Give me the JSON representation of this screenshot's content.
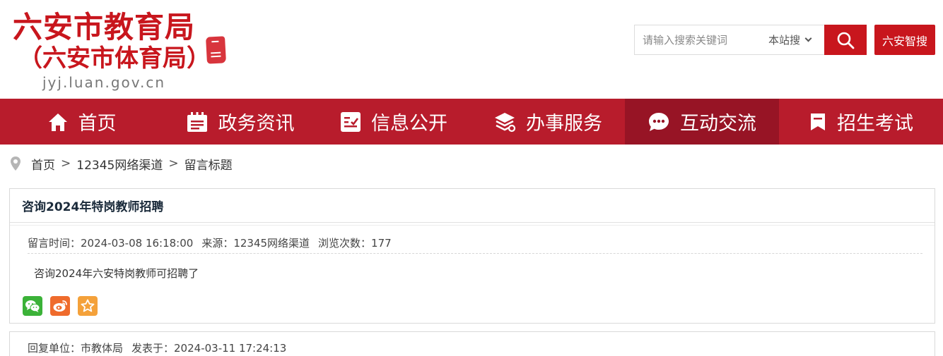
{
  "site": {
    "logo_main": "六安市教育局",
    "logo_sub": "（六安市体育局）",
    "logo_url": "jyj.luan.gov.cn"
  },
  "search": {
    "placeholder": "请输入搜索关键词",
    "scope": "本站搜",
    "search_icon": "search-icon",
    "zhisou_label": "六安智搜"
  },
  "nav": {
    "items": [
      {
        "label": "首页",
        "icon": "home-icon"
      },
      {
        "label": "政务资讯",
        "icon": "calendar-news-icon"
      },
      {
        "label": "信息公开",
        "icon": "info-card-icon"
      },
      {
        "label": "办事服务",
        "icon": "service-stack-icon"
      },
      {
        "label": "互动交流",
        "icon": "chat-bubble-icon",
        "active": true
      },
      {
        "label": "招生考试",
        "icon": "bookmark-flag-icon"
      }
    ]
  },
  "breadcrumb": {
    "icon": "location-pin-icon",
    "items": [
      "首页",
      "12345网络渠道",
      "留言标题"
    ],
    "separator": ">"
  },
  "message": {
    "title": "咨询2024年特岗教师招聘",
    "time": "留言时间：2024-03-08 16:18:00",
    "source": "来源：12345网络渠道",
    "views": "浏览次数：177",
    "content": "咨询2024年六安特岗教师可招聘了"
  },
  "share": {
    "icons": [
      "wechat-icon",
      "weibo-icon",
      "favorite-star-icon"
    ]
  },
  "reply": {
    "unit": "回复单位：市教体局",
    "published": "发表于：2024-03-11 17:24:13"
  },
  "colors": {
    "brand_red": "#c8161d",
    "nav_bg": "#b81c2c",
    "nav_active": "#971425",
    "wechat": "#3bb238",
    "weibo": "#ef6b2c",
    "favorite": "#f4a13a"
  }
}
